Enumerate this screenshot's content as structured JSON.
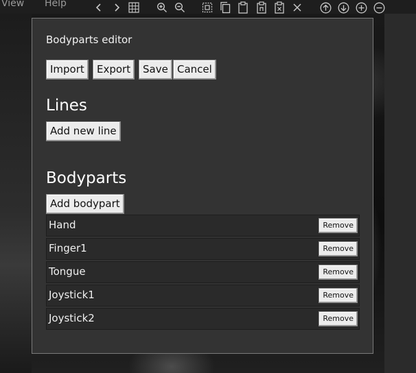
{
  "menubar": {
    "view_label": "View",
    "help_label": "Help"
  },
  "toolbar": {
    "icons": [
      "back-icon",
      "forward-icon",
      "grid-icon",
      "zoom-in-icon",
      "zoom-out-icon",
      "select-icon",
      "copy-icon",
      "paste-icon",
      "paste-special-icon",
      "clear-icon",
      "close-icon",
      "move-up-icon",
      "move-down-icon",
      "add-icon",
      "remove-icon"
    ]
  },
  "dialog": {
    "title": "Bodyparts editor",
    "import_label": "Import",
    "export_label": "Export",
    "save_label": "Save",
    "cancel_label": "Cancel",
    "lines_heading": "Lines",
    "add_line_label": "Add new line",
    "bodyparts_heading": "Bodyparts",
    "add_bodypart_label": "Add bodypart",
    "remove_label": "Remove",
    "bodyparts": [
      {
        "name": "Hand"
      },
      {
        "name": "Finger1"
      },
      {
        "name": "Tongue"
      },
      {
        "name": "Joystick1"
      },
      {
        "name": "Joystick2"
      }
    ]
  }
}
